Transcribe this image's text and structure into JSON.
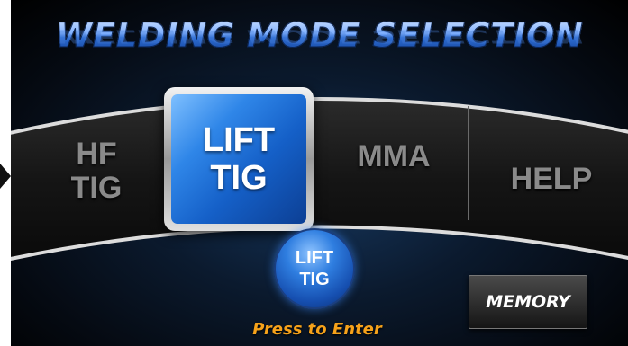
{
  "header": {
    "title": "WELDING MODE SELECTION"
  },
  "modes": [
    {
      "line1": "HF",
      "line2": "TIG"
    },
    {
      "line1": "LIFT",
      "line2": "TIG"
    },
    {
      "line1": "MMA",
      "line2": ""
    },
    {
      "line1": "HELP",
      "line2": ""
    }
  ],
  "selected_mode": {
    "line1": "LIFT",
    "line2": "TIG"
  },
  "enter_button": {
    "line1": "LIFT",
    "line2": "TIG",
    "caption": "Press to Enter"
  },
  "memory_button": {
    "label": "MEMORY"
  },
  "colors": {
    "accent": "#2f86e8",
    "enter_caption": "#f6a21a",
    "inactive_text": "#8a8a8a"
  }
}
